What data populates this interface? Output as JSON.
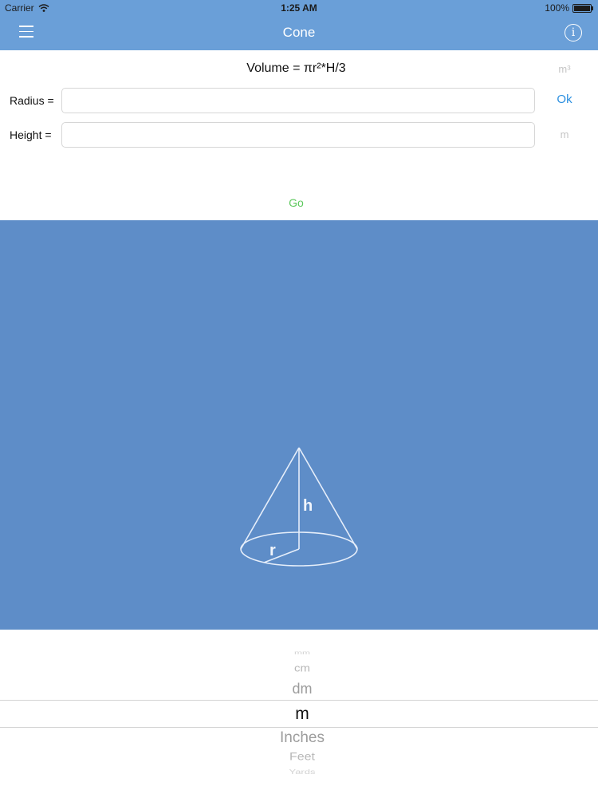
{
  "status_bar": {
    "carrier": "Carrier",
    "time": "1:25 AM",
    "battery": "100%"
  },
  "nav": {
    "title": "Cone",
    "menu_icon": "hamburger-menu-icon",
    "info_icon": "info-icon",
    "info_glyph": "i"
  },
  "form": {
    "formula": "Volume = πr²*H/3",
    "result_unit": "m³",
    "radius_label": "Radius =",
    "radius_value": "",
    "ok_label": "Ok",
    "height_label": "Height =",
    "height_value": "",
    "height_unit": "m",
    "go_label": "Go"
  },
  "diagram": {
    "height_label": "h",
    "radius_label": "r"
  },
  "unit_picker": {
    "options": [
      "mm",
      "cm",
      "dm",
      "m",
      "Inches",
      "Feet",
      "Yards"
    ],
    "selected": "m"
  },
  "colors": {
    "nav_background": "#6a9fd8",
    "diagram_background": "#5e8dc8",
    "ok_blue": "#2b8fe0",
    "go_green": "#5cc85c"
  }
}
